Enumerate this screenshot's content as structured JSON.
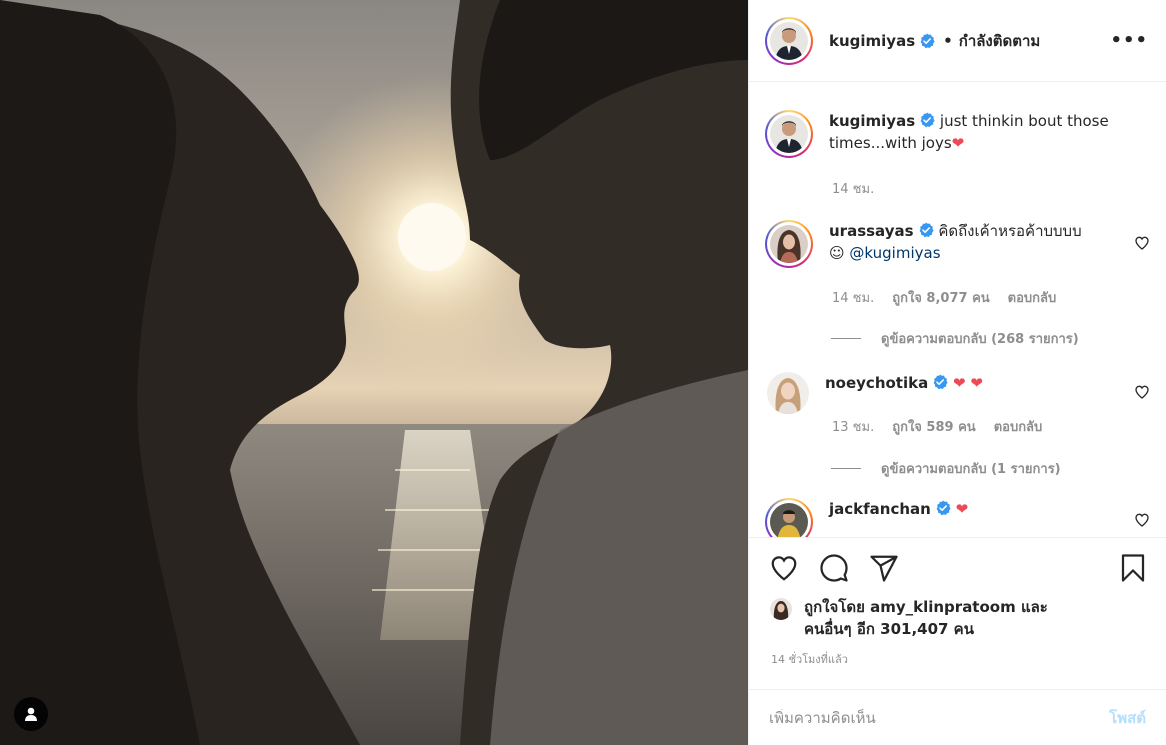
{
  "header": {
    "username": "kugimiyas",
    "separator": "•",
    "follow_status": "กำลังติดตาม",
    "more_label": "•••"
  },
  "caption": {
    "username": "kugimiyas",
    "text": "just thinkin bout those times...with joys",
    "emoji": "❤",
    "time": "14 ชม."
  },
  "comments": [
    {
      "username": "urassayas",
      "text": "คิดถึงเค้าหรอค้าบบบบ",
      "line2_prefix": "☺",
      "mention": "@kugimiyas",
      "time": "14 ชม.",
      "likes": "ถูกใจ 8,077 คน",
      "reply": "ตอบกลับ",
      "view_replies": "ดูข้อความตอบกลับ (268 รายการ)"
    },
    {
      "username": "noeychotika",
      "text": "❤ ❤",
      "time": "13 ชม.",
      "likes": "ถูกใจ 589 คน",
      "reply": "ตอบกลับ",
      "view_replies": "ดูข้อความตอบกลับ (1 รายการ)"
    },
    {
      "username": "jackfanchan",
      "text": "❤"
    }
  ],
  "likes": {
    "line1": "ถูกใจโดย amy_klinpratoom และ",
    "line2": "คนอื่นๆ อีก 301,407 คน"
  },
  "time_ago": "14 ชั่วโมงที่แล้ว",
  "add_comment": {
    "placeholder": "เพิ่มความคิดเห็น",
    "post_label": "โพสต์"
  },
  "colors": {
    "verified": "#3897f0",
    "heart": "#ed4956",
    "link": "#00376b",
    "muted": "#8e8e8e"
  }
}
